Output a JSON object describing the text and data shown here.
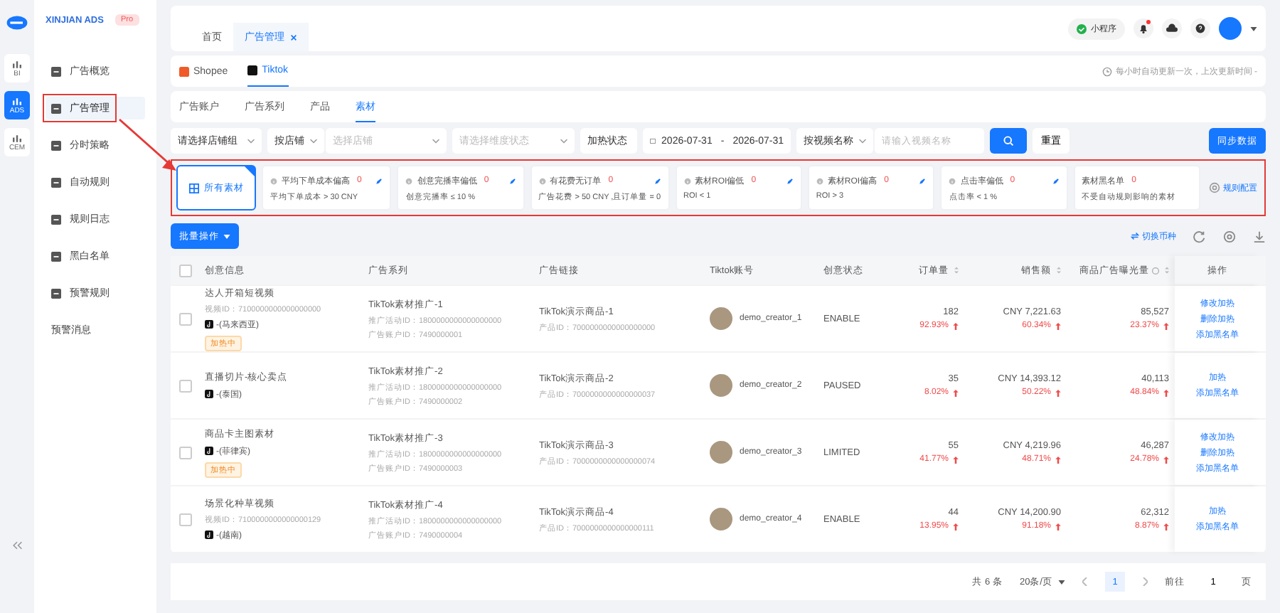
{
  "brand": {
    "name": "XINJIAN ADS",
    "badge": "Pro"
  },
  "rail": [
    {
      "label": "BI",
      "selected": false
    },
    {
      "label": "ADS",
      "selected": true
    },
    {
      "label": "CEM",
      "selected": false
    }
  ],
  "nav": [
    {
      "label": "广告概览",
      "selected": false,
      "kind": "icon"
    },
    {
      "label": "广告管理",
      "selected": true,
      "kind": "icon"
    },
    {
      "label": "分时策略",
      "selected": false,
      "kind": "icon"
    },
    {
      "label": "自动规则",
      "selected": false,
      "kind": "icon"
    },
    {
      "label": "规则日志",
      "selected": false,
      "kind": "icon"
    },
    {
      "label": "黑白名单",
      "selected": false,
      "kind": "icon"
    },
    {
      "label": "预警规则",
      "selected": false,
      "kind": "icon"
    },
    {
      "label": "预警消息",
      "selected": false,
      "kind": "text"
    }
  ],
  "page_tabs": [
    {
      "label": "首页",
      "selected": false,
      "closable": false
    },
    {
      "label": "广告管理",
      "selected": true,
      "closable": true
    }
  ],
  "header": {
    "mini_program": "小程序",
    "notification_dot": true
  },
  "platforms": [
    {
      "label": "Shopee",
      "selected": false
    },
    {
      "label": "Tiktok",
      "selected": true
    }
  ],
  "update_note": "每小时自动更新一次，上次更新时间 -",
  "sub_tabs": [
    {
      "label": "广告账户",
      "selected": false
    },
    {
      "label": "广告系列",
      "selected": false
    },
    {
      "label": "产品",
      "selected": false
    },
    {
      "label": "素材",
      "selected": true
    }
  ],
  "filters": {
    "shop_group": "请选择店铺组",
    "shop_mode": "按店铺",
    "shop_placeholder": "选择店铺",
    "status_placeholder": "请选择维度状态",
    "heat_status": "加热状态",
    "date_start": "2026-07-31",
    "date_sep": "-",
    "date_end": "2026-07-31",
    "search_mode": "按视频名称",
    "search_placeholder": "请输入视频名称",
    "reset": "重置",
    "sync": "同步数据"
  },
  "rules": [
    {
      "kind": "all",
      "label": "所有素材",
      "selected": true
    },
    {
      "kind": "rule",
      "label": "平均下单成本偏高",
      "count": "0",
      "condition": "平均下单成本 > 30 CNY",
      "selected": false
    },
    {
      "kind": "rule",
      "label": "创意完播率偏低",
      "count": "0",
      "condition": "创意完播率 ≤ 10 %",
      "selected": false
    },
    {
      "kind": "rule",
      "label": "有花费无订单",
      "count": "0",
      "condition": "广告花费 > 50 CNY ,且订单量 = 0",
      "selected": false
    },
    {
      "kind": "rule",
      "label": "素材ROI偏低",
      "count": "0",
      "condition": "ROI < 1",
      "selected": false
    },
    {
      "kind": "rule",
      "label": "素材ROI偏高",
      "count": "0",
      "condition": "ROI > 3",
      "selected": false
    },
    {
      "kind": "rule",
      "label": "点击率偏低",
      "count": "0",
      "condition": "点击率 < 1 %",
      "selected": false
    },
    {
      "kind": "list",
      "label": "素材黑名单",
      "count": "0",
      "condition": "不受自动规则影响的素材",
      "selected": false
    }
  ],
  "rule_settings": "规则配置",
  "batch": "批量操作",
  "currency_switch": "切换币种",
  "table": {
    "select_all_checked": false,
    "columns": [
      {
        "label": "创意信息",
        "sortable": false,
        "info": false
      },
      {
        "label": "广告系列",
        "sortable": false,
        "info": false
      },
      {
        "label": "广告链接",
        "sortable": false,
        "info": false
      },
      {
        "label": "Tiktok账号",
        "sortable": false,
        "info": false
      },
      {
        "label": "创意状态",
        "sortable": false,
        "info": false
      },
      {
        "label": "订单量",
        "sortable": true,
        "info": false
      },
      {
        "label": "销售额",
        "sortable": true,
        "info": false
      },
      {
        "label": "商品广告曝光量",
        "sortable": true,
        "info": true
      },
      {
        "label": "操作",
        "sortable": false,
        "info": false
      }
    ],
    "rows": [
      {
        "checked": false,
        "title": "达人开箱短视频",
        "video_id": "视频ID：7100000000000000000",
        "region": "-(马来西亚)",
        "badge": "加热中",
        "campaign": "TikTok素材推广-1",
        "campaign_id": "推广活动ID：1800000000000000000",
        "account_id": "广告账户ID：7490000001",
        "product": "TikTok演示商品-1",
        "product_id": "产品ID：7000000000000000000",
        "creator": "demo_creator_1",
        "status": "ENABLE",
        "orders": {
          "value": "182",
          "change": "92.93%"
        },
        "sales": {
          "value": "CNY 7,221.63",
          "change": "60.34%"
        },
        "exposure": {
          "value": "85,527",
          "change": "23.37%"
        },
        "actions": [
          "修改加热",
          "删除加热",
          "添加黑名单"
        ]
      },
      {
        "checked": false,
        "title": "直播切片-核心卖点",
        "region": "-(泰国)",
        "campaign": "TikTok素材推广-2",
        "campaign_id": "推广活动ID：1800000000000000000",
        "account_id": "广告账户ID：7490000002",
        "product": "TikTok演示商品-2",
        "product_id": "产品ID：7000000000000000037",
        "creator": "demo_creator_2",
        "status": "PAUSED",
        "orders": {
          "value": "35",
          "change": "8.02%"
        },
        "sales": {
          "value": "CNY 14,393.12",
          "change": "50.22%"
        },
        "exposure": {
          "value": "40,113",
          "change": "48.84%"
        },
        "actions": [
          "加热",
          "添加黑名单"
        ]
      },
      {
        "checked": false,
        "title": "商品卡主图素材",
        "region": "-(菲律宾)",
        "badge": "加热中",
        "campaign": "TikTok素材推广-3",
        "campaign_id": "推广活动ID：1800000000000000000",
        "account_id": "广告账户ID：7490000003",
        "product": "TikTok演示商品-3",
        "product_id": "产品ID：7000000000000000074",
        "creator": "demo_creator_3",
        "status": "LIMITED",
        "orders": {
          "value": "55",
          "change": "41.77%"
        },
        "sales": {
          "value": "CNY 4,219.96",
          "change": "48.71%"
        },
        "exposure": {
          "value": "46,287",
          "change": "24.78%"
        },
        "actions": [
          "修改加热",
          "删除加热",
          "添加黑名单"
        ]
      },
      {
        "checked": false,
        "title": "场景化种草视频",
        "video_id": "视频ID：7100000000000000129",
        "region": "-(越南)",
        "campaign": "TikTok素材推广-4",
        "campaign_id": "推广活动ID：1800000000000000000",
        "account_id": "广告账户ID：7490000004",
        "product": "TikTok演示商品-4",
        "product_id": "产品ID：7000000000000000111",
        "creator": "demo_creator_4",
        "status": "ENABLE",
        "orders": {
          "value": "44",
          "change": "13.95%"
        },
        "sales": {
          "value": "CNY 14,200.90",
          "change": "91.18%"
        },
        "exposure": {
          "value": "62,312",
          "change": "8.87%"
        },
        "actions": [
          "加热",
          "添加黑名单"
        ]
      }
    ]
  },
  "pagination": {
    "total": "共 6 条",
    "page_size": "20条/页",
    "pages": [
      {
        "label": "1",
        "selected": true
      }
    ],
    "goto": "前往",
    "goto_value": "1",
    "page_suffix": "页"
  }
}
